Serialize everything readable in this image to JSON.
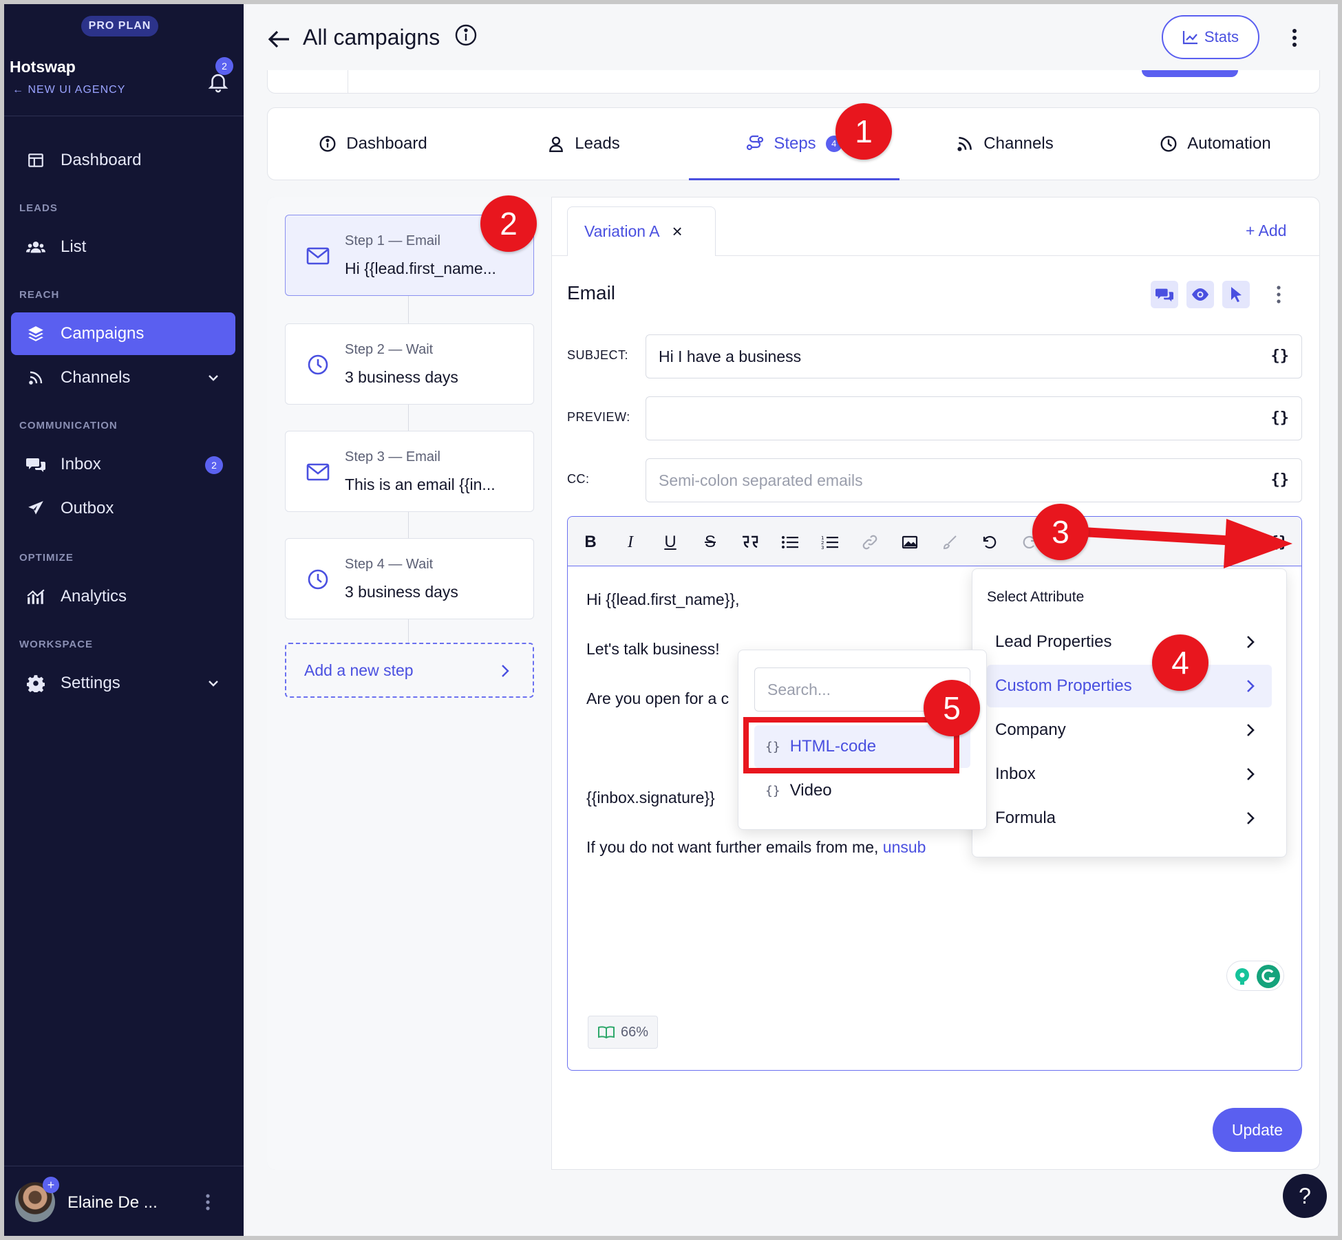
{
  "sidebar": {
    "plan_badge": "PRO PLAN",
    "workspace": "Hotswap",
    "agency_link": "NEW UI AGENCY",
    "notification_count": "2",
    "items": {
      "dashboard": "Dashboard",
      "leads_section": "LEADS",
      "list": "List",
      "reach_section": "REACH",
      "campaigns": "Campaigns",
      "channels": "Channels",
      "communication_section": "COMMUNICATION",
      "inbox": "Inbox",
      "inbox_count": "2",
      "outbox": "Outbox",
      "optimize_section": "OPTIMIZE",
      "analytics": "Analytics",
      "workspace_section": "WORKSPACE",
      "settings": "Settings"
    },
    "user_name": "Elaine De ...",
    "avatar_plus": "+"
  },
  "header": {
    "title": "All campaigns",
    "stats_label": "Stats"
  },
  "tabs": [
    {
      "label": "Dashboard",
      "icon": "info-icon"
    },
    {
      "label": "Leads",
      "icon": "user-icon"
    },
    {
      "label": "Steps",
      "icon": "steps-icon",
      "count": "4"
    },
    {
      "label": "Channels",
      "icon": "rss-icon"
    },
    {
      "label": "Automation",
      "icon": "clock-icon"
    }
  ],
  "steps": [
    {
      "meta": "Step 1 — Email",
      "subject": "Hi {{lead.first_name...",
      "icon": "mail-icon"
    },
    {
      "meta": "Step 2 — Wait",
      "subject": "3 business days",
      "icon": "clock-icon"
    },
    {
      "meta": "Step 3 — Email",
      "subject": "This is an email {{in...",
      "icon": "mail-icon"
    },
    {
      "meta": "Step 4 — Wait",
      "subject": "3 business days",
      "icon": "clock-icon"
    }
  ],
  "add_step_label": "Add a new step",
  "variation": {
    "tab_label": "Variation A",
    "close": "×",
    "add_label": "+ Add"
  },
  "email": {
    "heading": "Email",
    "subject_label": "SUBJECT:",
    "subject_value": "Hi I have a business",
    "preview_label": "PREVIEW:",
    "preview_value": "",
    "cc_label": "CC:",
    "cc_placeholder": "Semi-colon separated emails",
    "brace": "{}"
  },
  "editor": {
    "line1": "Hi {{lead.first_name}},",
    "line2": "Let's talk business!",
    "line3": "Are you open for a c",
    "line4": "{{inbox.signature}}",
    "line5": "If you do not want further emails from me, ",
    "line5_link": "unsub",
    "readability": "66%"
  },
  "attribute_menu": {
    "title": "Select Attribute",
    "items": [
      "Lead Properties",
      "Custom Properties",
      "Company",
      "Inbox",
      "Formula"
    ]
  },
  "sub_menu": {
    "search_placeholder": "Search...",
    "items": [
      "HTML-code",
      "Video"
    ]
  },
  "update_label": "Update",
  "help_label": "?",
  "annotations": [
    "1",
    "2",
    "3",
    "4",
    "5"
  ],
  "colors": {
    "accent": "#5a5ff0",
    "sidebar_bg": "#131533",
    "annotation_red": "#e8161e"
  }
}
